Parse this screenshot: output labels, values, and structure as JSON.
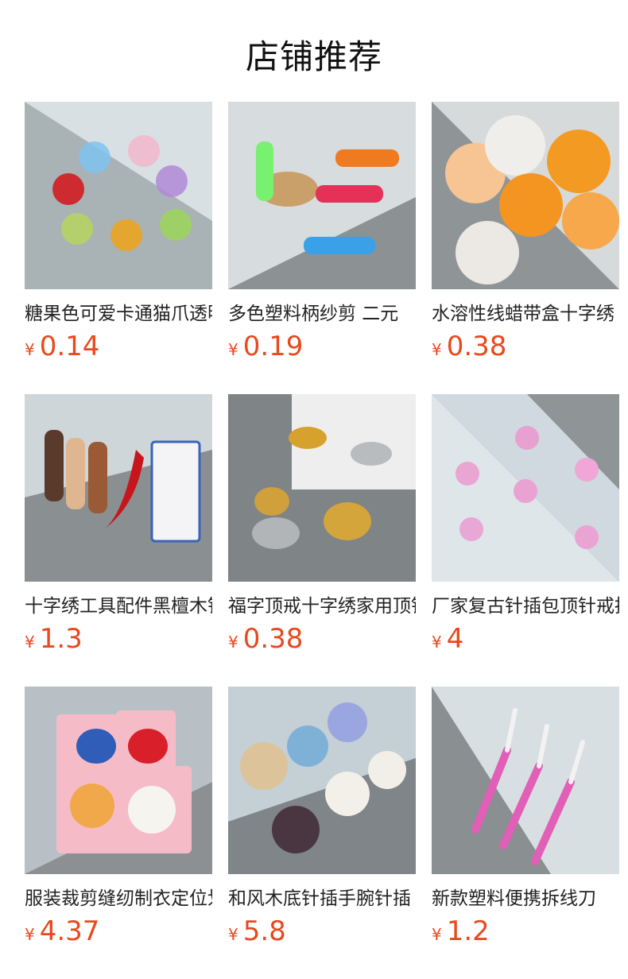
{
  "title": "店铺推荐",
  "products": [
    {
      "name": "糖果色可爱卡通猫爪透明穿线器",
      "currency": "¥",
      "price": "0.14",
      "icon": "cat-paw-needle-threaders"
    },
    {
      "name": "多色塑料柄纱剪 二元",
      "currency": "¥",
      "price": "0.19",
      "icon": "thread-snips"
    },
    {
      "name": "水溶性线蜡带盒十字绣",
      "currency": "¥",
      "price": "0.38",
      "icon": "thread-wax-box"
    },
    {
      "name": "十字绣工具配件黑檀木针筒",
      "currency": "¥",
      "price": "1.3",
      "icon": "needle-cases"
    },
    {
      "name": "福字顶戒十字绣家用顶针",
      "currency": "¥",
      "price": "0.38",
      "icon": "thimble-rings"
    },
    {
      "name": "厂家复古针插包顶针戒指",
      "currency": "¥",
      "price": "4",
      "icon": "pincushion-rings"
    },
    {
      "name": "服装裁剪缝纫制衣定位划粉",
      "currency": "¥",
      "price": "4.37",
      "icon": "chalk-wheel"
    },
    {
      "name": "和风木底针插手腕针插",
      "currency": "¥",
      "price": "5.8",
      "icon": "wrist-pincushion"
    },
    {
      "name": "新款塑料便携拆线刀",
      "currency": "¥",
      "price": "1.2",
      "icon": "seam-ripper"
    }
  ]
}
